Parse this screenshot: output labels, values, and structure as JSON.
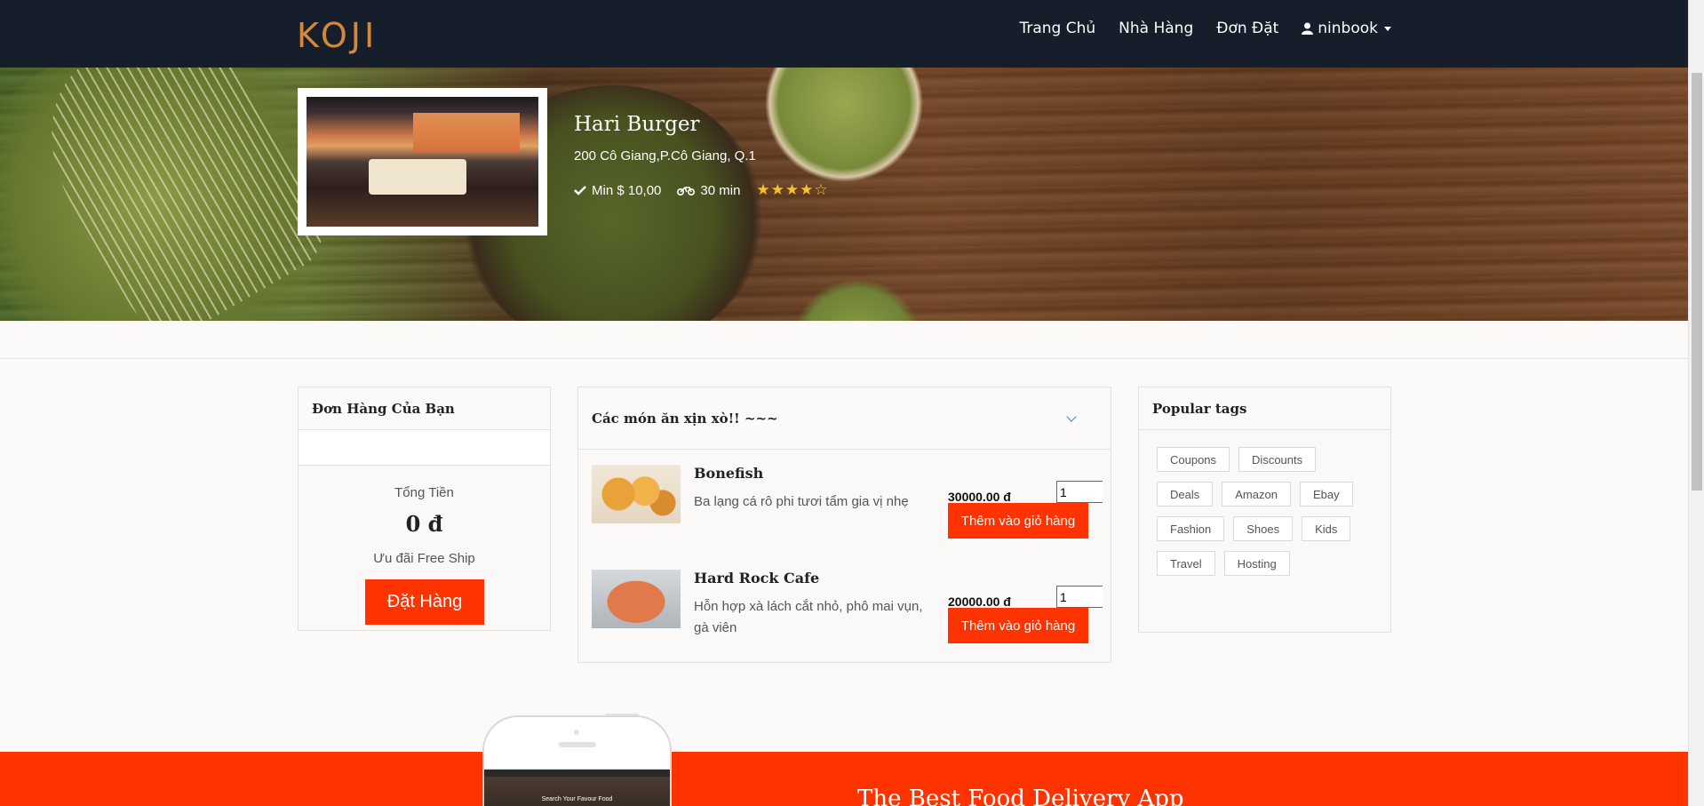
{
  "navbar": {
    "logo": "KOJI",
    "links": [
      "Trang Chủ",
      "Nhà Hàng",
      "Đơn Đặt"
    ],
    "user": "ninbook"
  },
  "restaurant": {
    "name": "Hari Burger",
    "address": "200 Cô Giang,P.Cô Giang, Q.1",
    "min_order": "Min $ 10,00",
    "delivery_time": "30 min",
    "rating": "★★★★☆"
  },
  "order": {
    "title": "Đơn Hàng Của Bạn",
    "total_label": "Tổng Tiền",
    "total": "0 đ",
    "promo": "Ưu đãi Free Ship",
    "button": "Đặt Hàng"
  },
  "menu": {
    "title": "Các món ăn xịn xò!! ~~~",
    "items": [
      {
        "name": "Bonefish",
        "description": "Ba lạng cá rô phi tươi tẩm gia vị nhẹ",
        "price": "30000.00 đ",
        "qty": "1",
        "button": "Thêm vào giỏ hàng"
      },
      {
        "name": "Hard Rock Cafe",
        "description": "Hỗn hợp xà lách cắt nhỏ, phô mai vụn, gà viên",
        "price": "20000.00 đ",
        "qty": "1",
        "button": "Thêm vào giỏ hàng"
      }
    ]
  },
  "tags": {
    "title": "Popular tags",
    "items": [
      "Coupons",
      "Discounts",
      "Deals",
      "Amazon",
      "Ebay",
      "Fashion",
      "Shoes",
      "Kids",
      "Travel",
      "Hosting"
    ]
  },
  "footer": {
    "title": "The Best Food Delivery App",
    "phone_screen_text": "Search Your Favour Food"
  },
  "colors": {
    "accent": "#ff3300",
    "navbar": "#161d2b",
    "logo": "#d4893a",
    "stars": "#f4c32d"
  }
}
